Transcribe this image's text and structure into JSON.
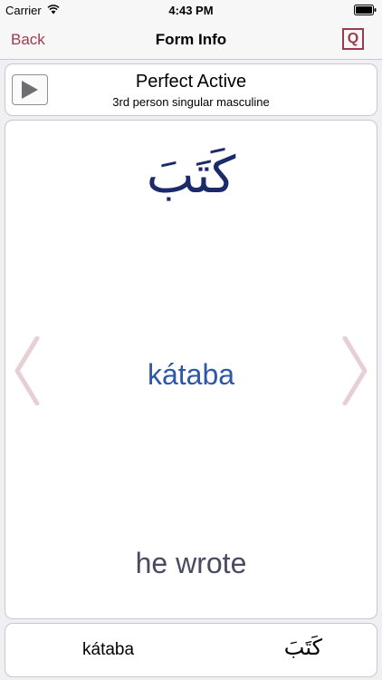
{
  "status_bar": {
    "carrier": "Carrier",
    "time": "4:43 PM"
  },
  "nav": {
    "back_label": "Back",
    "title": "Form Info",
    "quiz_label": "Q"
  },
  "form": {
    "title": "Perfect Active",
    "subtitle": "3rd person singular masculine"
  },
  "card": {
    "arabic": "كَتَبَ",
    "transliteration": "kátaba",
    "translation": "he wrote"
  },
  "bottom": {
    "transliteration": "kátaba",
    "arabic": "كَتَبَ"
  },
  "colors": {
    "accent": "#9b3b4d",
    "arabic": "#1b2a6b",
    "transliteration": "#2e57a8",
    "translation": "#4a4a63",
    "arrow": "#e7cfd4"
  },
  "icons": {
    "play": "play-icon",
    "wifi": "wifi-icon",
    "battery": "battery-icon",
    "prev": "chevron-left-icon",
    "next": "chevron-right-icon"
  }
}
